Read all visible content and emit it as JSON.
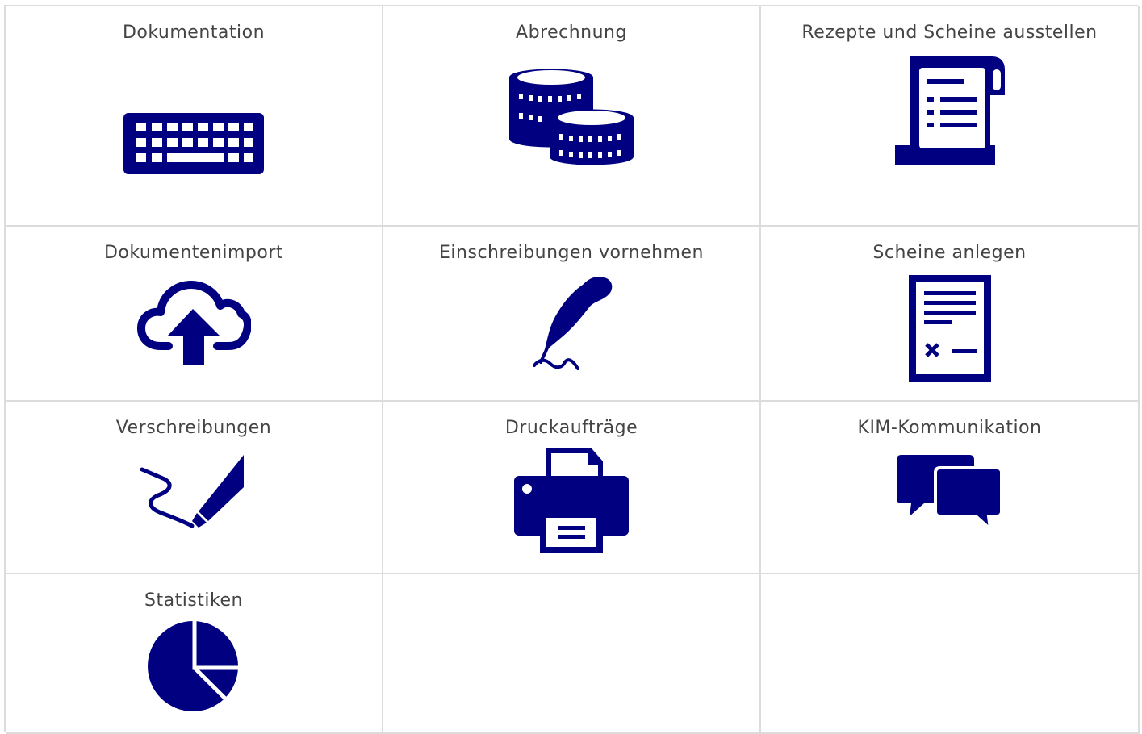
{
  "colors": {
    "icon": "#000080",
    "label": "#444444",
    "grid_line": "#dcdcdc",
    "background": "#ffffff"
  },
  "tiles": [
    {
      "label": "Dokumentation",
      "icon": "keyboard-icon"
    },
    {
      "label": "Abrechnung",
      "icon": "coins-icon"
    },
    {
      "label": "Rezepte und Scheine ausstellen",
      "icon": "receipt-scroll-icon"
    },
    {
      "label": "Dokumentenimport",
      "icon": "cloud-upload-icon"
    },
    {
      "label": "Einschreibungen vornehmen",
      "icon": "quill-signature-icon"
    },
    {
      "label": "Scheine anlegen",
      "icon": "form-document-icon"
    },
    {
      "label": "Verschreibungen",
      "icon": "pen-signature-icon"
    },
    {
      "label": "Druckaufträge",
      "icon": "printer-icon"
    },
    {
      "label": "KIM-Kommunikation",
      "icon": "chat-bubbles-icon"
    },
    {
      "label": "Statistiken",
      "icon": "pie-chart-icon"
    }
  ]
}
